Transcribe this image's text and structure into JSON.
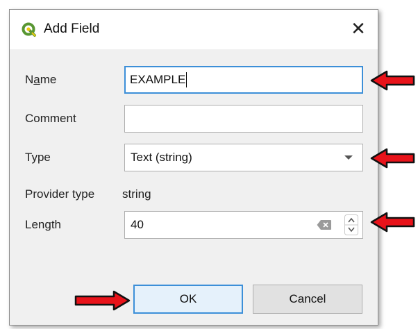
{
  "dialog": {
    "title": "Add Field",
    "close_glyph": "✕",
    "icon": "qgis-logo-icon"
  },
  "form": {
    "name_label": "Name",
    "name_value": "EXAMPLE",
    "comment_label": "Comment",
    "comment_value": "",
    "type_label": "Type",
    "type_value": "Text (string)",
    "provider_type_label": "Provider type",
    "provider_type_value": "string",
    "length_label": "Length",
    "length_value": "40"
  },
  "buttons": {
    "ok_label": "OK",
    "cancel_label": "Cancel"
  },
  "colors": {
    "accent": "#3c8fd8",
    "annotation_arrow": "#e8131a",
    "qgis_green": "#589632",
    "qgis_yellow": "#eec90d"
  }
}
